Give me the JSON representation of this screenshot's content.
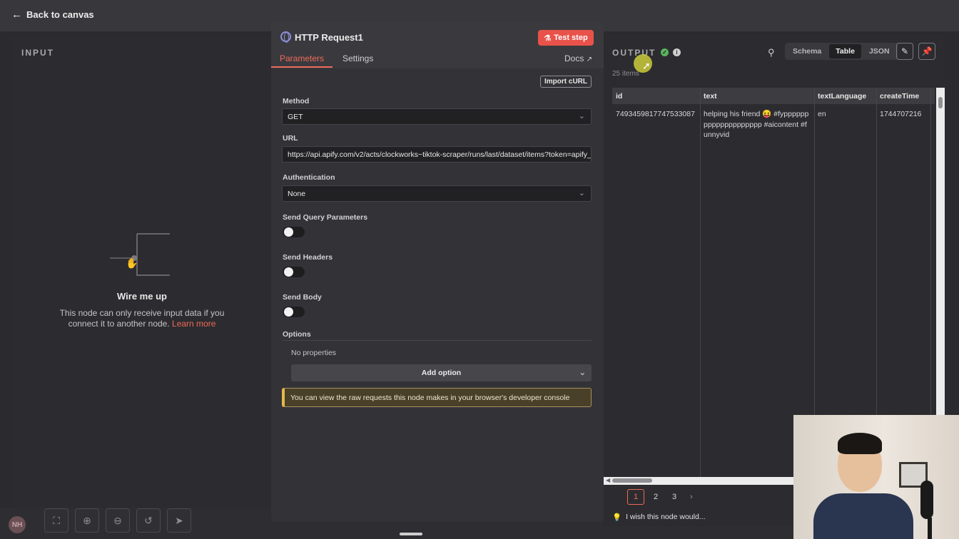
{
  "topbar": {
    "back_label": "Back to canvas"
  },
  "input_panel": {
    "title": "INPUT",
    "wire_title": "Wire me up",
    "wire_text": "This node can only receive input data if you connect it to another node.",
    "learn_more": "Learn more"
  },
  "node": {
    "title": "HTTP Request1",
    "test_step": "Test step",
    "tabs": {
      "parameters": "Parameters",
      "settings": "Settings"
    },
    "docs": "Docs",
    "import_curl": "Import cURL",
    "method": {
      "label": "Method",
      "value": "GET"
    },
    "url": {
      "label": "URL",
      "value": "https://api.apify.com/v2/acts/clockworks~tiktok-scraper/runs/last/dataset/items?token=apify_"
    },
    "authentication": {
      "label": "Authentication",
      "value": "None"
    },
    "send_query": {
      "label": "Send Query Parameters",
      "enabled": false
    },
    "send_headers": {
      "label": "Send Headers",
      "enabled": false
    },
    "send_body": {
      "label": "Send Body",
      "enabled": false
    },
    "options": {
      "label": "Options",
      "no_properties": "No properties",
      "add_option": "Add option"
    },
    "notice": "You can view the raw requests this node makes in your browser's developer console"
  },
  "output": {
    "title": "OUTPUT",
    "items_count": "25 items",
    "views": [
      "Schema",
      "Table",
      "JSON"
    ],
    "active_view": "Table",
    "columns": [
      "id",
      "text",
      "textLanguage",
      "createTime"
    ],
    "rows": [
      {
        "id": "7493459817747533087",
        "text": "helping his friend 😝 #fypppppppppppppppppppp #aicontent #funnyvid",
        "textLanguage": "en",
        "createTime": "1744707216"
      }
    ],
    "pages": [
      "1",
      "2",
      "3"
    ],
    "current_page": "1",
    "wish": "I wish this node would..."
  },
  "canvas": {
    "avatar_initials": "NH"
  },
  "colors": {
    "accent": "#ee6a58",
    "success": "#58b45c",
    "test_button": "#e9524a"
  }
}
